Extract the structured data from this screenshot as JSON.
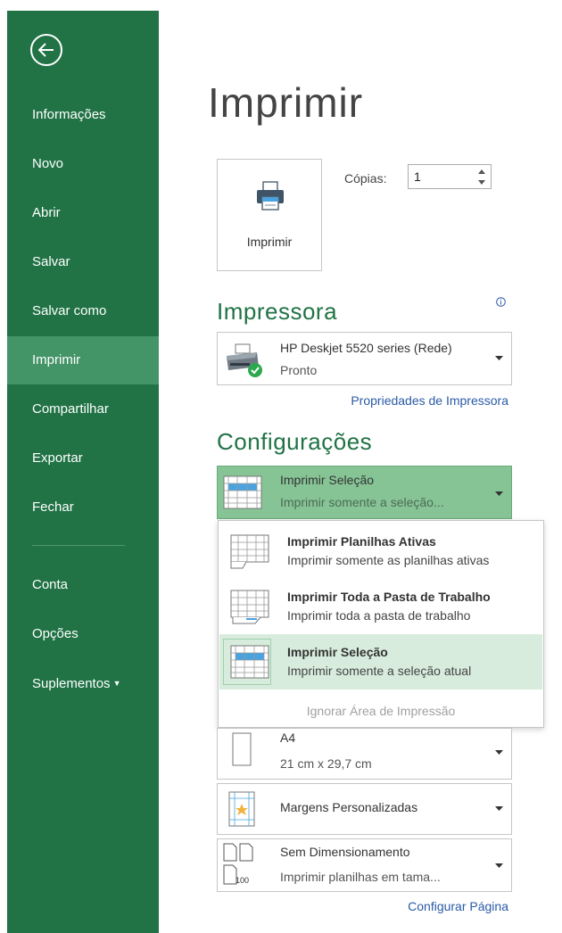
{
  "sidebar": {
    "items": [
      {
        "label": "Informações"
      },
      {
        "label": "Novo"
      },
      {
        "label": "Abrir"
      },
      {
        "label": "Salvar"
      },
      {
        "label": "Salvar como"
      },
      {
        "label": "Imprimir"
      },
      {
        "label": "Compartilhar"
      },
      {
        "label": "Exportar"
      },
      {
        "label": "Fechar"
      },
      {
        "label": "Conta"
      },
      {
        "label": "Opções"
      },
      {
        "label": "Suplementos"
      }
    ],
    "active_item": "Imprimir"
  },
  "page": {
    "title": "Imprimir"
  },
  "print": {
    "button_label": "Imprimir",
    "copies_label": "Cópias:",
    "copies_value": "1"
  },
  "printer": {
    "section_title": "Impressora",
    "name": "HP Deskjet 5520 series (Rede)",
    "status": "Pronto",
    "properties_link": "Propriedades de Impressora"
  },
  "settings": {
    "section_title": "Configurações",
    "scope": {
      "title": "Imprimir Seleção",
      "subtitle": "Imprimir somente a seleção..."
    },
    "scope_options": [
      {
        "title": "Imprimir Planilhas Ativas",
        "subtitle": "Imprimir somente as planilhas ativas"
      },
      {
        "title": "Imprimir Toda a Pasta de Trabalho",
        "subtitle": "Imprimir toda a pasta de trabalho"
      },
      {
        "title": "Imprimir Seleção",
        "subtitle": "Imprimir somente a seleção atual"
      }
    ],
    "ignore_print_area": "Ignorar Área de Impressão",
    "paper": {
      "title": "A4",
      "subtitle": "21 cm x 29,7 cm"
    },
    "margins": {
      "title": "Margens Personalizadas"
    },
    "scaling": {
      "title": "Sem Dimensionamento",
      "subtitle": "Imprimir planilhas em tama...",
      "icon_text": "100"
    },
    "page_setup_link": "Configurar Página"
  },
  "colors": {
    "brand_green": "#217346",
    "sidebar_active": "#439467",
    "link_blue": "#2a5aa6",
    "selected_fill": "#86c496"
  }
}
